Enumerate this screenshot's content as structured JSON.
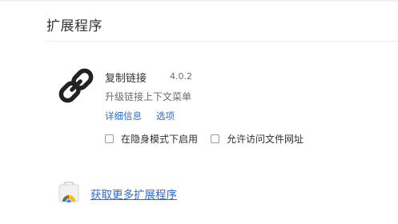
{
  "page": {
    "title": "扩展程序"
  },
  "extension": {
    "name": "复制链接",
    "version": "4.0.2",
    "description": "升级链接上下文菜单",
    "icon": "chain-link-icon",
    "details_label": "详细信息",
    "options_label": "选项",
    "allow_incognito_label": "在隐身模式下启用",
    "allow_incognito_checked": false,
    "allow_file_urls_label": "允许访问文件网址",
    "allow_file_urls_checked": false
  },
  "store": {
    "icon": "chrome-web-store-icon",
    "link_label": "获取更多扩展程序"
  }
}
